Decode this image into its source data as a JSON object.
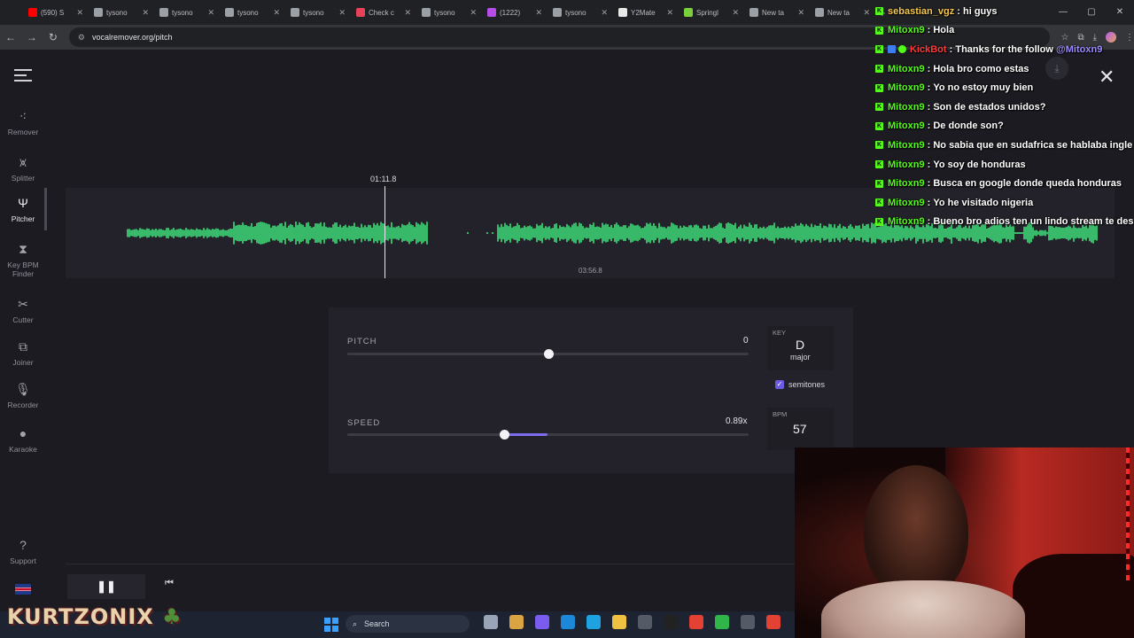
{
  "browser": {
    "tabs": [
      {
        "label": "(590) S",
        "icon": "youtube-icon",
        "color": "#ff0000"
      },
      {
        "label": "tysono",
        "icon": "globe-icon",
        "color": "#9aa0a6"
      },
      {
        "label": "tysono",
        "icon": "globe-icon",
        "color": "#9aa0a6"
      },
      {
        "label": "tysono",
        "icon": "globe-icon",
        "color": "#9aa0a6"
      },
      {
        "label": "tysono",
        "icon": "globe-icon",
        "color": "#9aa0a6"
      },
      {
        "label": "Check c",
        "icon": "calendar-icon",
        "color": "#e8415a"
      },
      {
        "label": "tysono",
        "icon": "globe-icon",
        "color": "#9aa0a6"
      },
      {
        "label": "(1222)",
        "icon": "stream-icon",
        "color": "#b84de8"
      },
      {
        "label": "tysono",
        "icon": "globe-icon",
        "color": "#9aa0a6"
      },
      {
        "label": "Y2Mate",
        "icon": "y2mate-icon",
        "color": "#e8e8e8"
      },
      {
        "label": "Springl",
        "icon": "springboard-icon",
        "color": "#7bcf3a"
      },
      {
        "label": "New ta",
        "icon": "chrome-icon",
        "color": "#9aa0a6"
      },
      {
        "label": "New ta",
        "icon": "chrome-icon",
        "color": "#9aa0a6"
      }
    ],
    "url": "vocalremover.org/pitch"
  },
  "sidebar": {
    "items": [
      {
        "label": "Remover",
        "icon": "remover-icon",
        "glyph": "⁖"
      },
      {
        "label": "Splitter",
        "icon": "splitter-icon",
        "glyph": "⩙"
      },
      {
        "label": "Pitcher",
        "icon": "tuning-fork-icon",
        "glyph": "Ψ"
      },
      {
        "label": "Key BPM Finder",
        "icon": "metronome-icon",
        "glyph": "⧗"
      },
      {
        "label": "Cutter",
        "icon": "scissors-icon",
        "glyph": "✂"
      },
      {
        "label": "Joiner",
        "icon": "joiner-icon",
        "glyph": "⧉"
      },
      {
        "label": "Recorder",
        "icon": "microphone-icon",
        "glyph": "🎙"
      },
      {
        "label": "Karaoke",
        "icon": "karaoke-icon",
        "glyph": "●"
      }
    ],
    "support": "Support"
  },
  "player": {
    "current_time": "01:11.8",
    "total_time": "03:56.8",
    "waveform_color": "#3ee07a"
  },
  "controls": {
    "pitch_label": "PITCH",
    "pitch_value": "0",
    "pitch_position": 0.5,
    "speed_label": "SPEED",
    "speed_value": "0.89x",
    "speed_position": 0.39,
    "key_label": "KEY",
    "key_value": "D",
    "key_mode": "major",
    "semitones_label": "semitones",
    "semitones_checked": true,
    "bpm_label": "BPM",
    "bpm_value": "57",
    "accent_color": "#7b6cf0"
  },
  "chat": [
    {
      "user": "sebastian_vgz",
      "message": "hi guys",
      "user_color": "#f5c84c"
    },
    {
      "user": "Mitoxn9",
      "message": "Hola"
    },
    {
      "user": "KickBot",
      "message": "Thanks for the follow",
      "mention": "@Mitoxn9",
      "user_color": "#ff3b3b"
    },
    {
      "user": "Mitoxn9",
      "message": "Hola bro como estas"
    },
    {
      "user": "Mitoxn9",
      "message": "Yo no estoy muy bien"
    },
    {
      "user": "Mitoxn9",
      "message": "Son de estados unidos?"
    },
    {
      "user": "Mitoxn9",
      "message": "De donde son?"
    },
    {
      "user": "Mitoxn9",
      "message": "No sabia que en sudafrica se hablaba ingle"
    },
    {
      "user": "Mitoxn9",
      "message": "Yo soy de honduras"
    },
    {
      "user": "Mitoxn9",
      "message": "Busca en google donde queda honduras"
    },
    {
      "user": "Mitoxn9",
      "message": "Yo he visitado nigeria"
    },
    {
      "user": "Mitoxn9",
      "message": "Bueno bro adios ten un lindo stream te des"
    }
  ],
  "taskbar": {
    "search_label": "Search",
    "overlay_logo": "KURTZONIX"
  }
}
